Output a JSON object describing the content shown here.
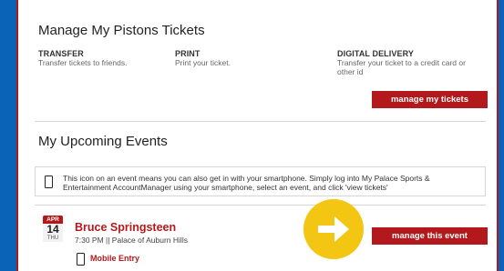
{
  "tickets": {
    "title": "Manage My Pistons Tickets",
    "columns": [
      {
        "title": "TRANSFER",
        "desc": "Transfer tickets to friends."
      },
      {
        "title": "PRINT",
        "desc": "Print your ticket."
      },
      {
        "title": "DIGITAL DELIVERY",
        "desc": "Transfer your ticket to a credit card or other id"
      }
    ],
    "button_label": "manage my tickets"
  },
  "events": {
    "title": "My Upcoming Events",
    "notice_text": "This icon on an event means you can also get in with your smartphone. Simply log into My Palace Sports & Entertainment AccountManager using your smartphone, select an event, and click 'view tickets'",
    "items": [
      {
        "month": "APR",
        "day": "14",
        "weekday": "THU",
        "name": "Bruce Springsteen",
        "info": "7:30 PM || Palace of Auburn Hills",
        "mobile_label": "Mobile Entry",
        "button_label": "manage this event"
      }
    ]
  },
  "colors": {
    "accent": "#b3191c",
    "background": "#0b63b8",
    "highlight": "#f2c612"
  },
  "icons": [
    "smartphone-icon",
    "arrow-right-icon"
  ]
}
